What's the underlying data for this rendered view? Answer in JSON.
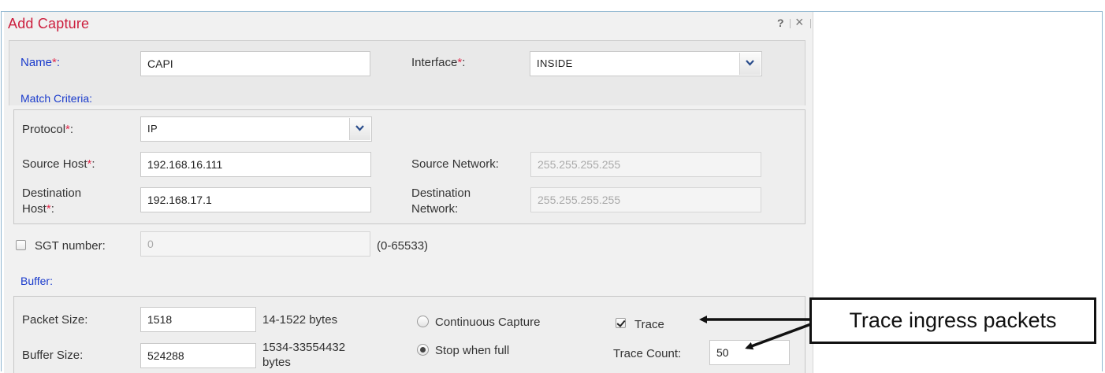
{
  "dialog": {
    "title": "Add Capture",
    "help": "?",
    "close": "×"
  },
  "fields": {
    "name": {
      "label": "Name",
      "required_mark": "*",
      "colon": ":",
      "value": "CAPI"
    },
    "interface": {
      "label": "Interface",
      "required_mark": "*",
      "colon": ":",
      "value": "INSIDE"
    },
    "match_criteria": "Match Criteria:",
    "protocol": {
      "label": "Protocol",
      "required_mark": "*",
      "colon": ":",
      "value": "IP"
    },
    "source_host": {
      "label": "Source Host",
      "required_mark": "*",
      "colon": ":",
      "value": "192.168.16.111"
    },
    "source_network": {
      "label": "Source Network:",
      "value": "255.255.255.255"
    },
    "destination_host": {
      "label_line1": "Destination",
      "label_line2": "Host",
      "required_mark": "*",
      "colon": ":",
      "value": "192.168.17.1"
    },
    "destination_network": {
      "label_line1": "Destination",
      "label_line2": "Network:",
      "value": "255.255.255.255"
    },
    "sgt": {
      "label": "SGT number:",
      "value": "0",
      "range": "(0-65533)",
      "checked": false
    },
    "buffer": "Buffer:",
    "packet_size": {
      "label": "Packet Size:",
      "value": "1518",
      "hint": "14-1522 bytes"
    },
    "buffer_size": {
      "label": "Buffer Size:",
      "value": "524288",
      "hint_line1": "1534-33554432",
      "hint_line2": "bytes"
    },
    "continuous_capture": {
      "label": "Continuous Capture",
      "selected": false
    },
    "stop_when_full": {
      "label": "Stop when full",
      "selected": true
    },
    "trace": {
      "label": "Trace",
      "checked": true
    },
    "trace_count": {
      "label": "Trace Count:",
      "value": "50"
    }
  },
  "annotation": {
    "text": "Trace ingress packets"
  },
  "colors": {
    "title": "#cc1f3e",
    "section_label": "#1a3bcc",
    "required": "#e2284a",
    "frame_border": "#8fb6d0"
  }
}
